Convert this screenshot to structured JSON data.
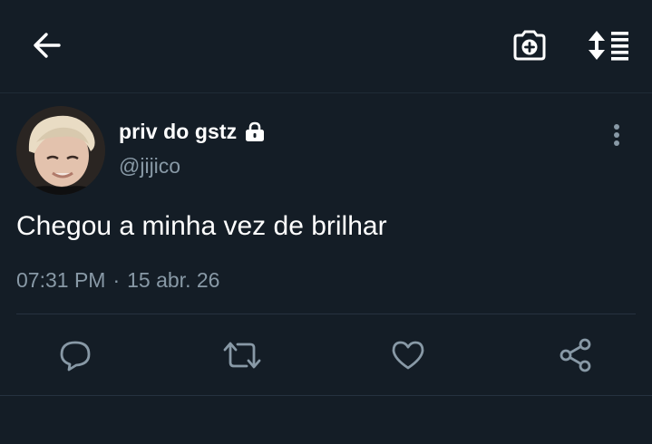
{
  "tweet": {
    "display_name": "priv do gstz",
    "handle": "@jijico",
    "text": "Chegou a minha vez de brilhar",
    "time": "07:31 PM",
    "separator": "·",
    "date": "15 abr. 26",
    "protected": true
  },
  "icons": {
    "back": "arrow-left-icon",
    "camera": "camera-plus-icon",
    "sort": "sort-list-icon",
    "more": "vertical-dots-icon",
    "lock": "lock-icon",
    "reply": "reply-icon",
    "retweet": "retweet-icon",
    "like": "heart-icon",
    "share": "share-icon"
  },
  "colors": {
    "background": "#141d26",
    "primary_text": "#ffffff",
    "secondary_text": "#8899a6",
    "divider": "#26323f"
  }
}
